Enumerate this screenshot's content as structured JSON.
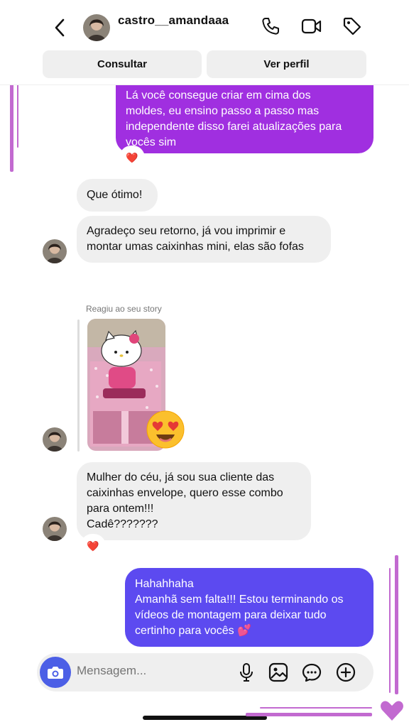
{
  "header": {
    "username": "castro__amandaaa",
    "consult_label": "Consultar",
    "profile_label": "Ver perfil"
  },
  "messages": {
    "m1": {
      "lines": [
        "Lá você consegue criar em cima dos",
        "moldes, eu ensino passo a passo mas",
        "independente disso farei atualizações para",
        "vocês sim"
      ],
      "reaction": "❤️"
    },
    "m2": {
      "lines": [
        "Que ótimo!"
      ]
    },
    "m3": {
      "lines": [
        "Agradeço seu retorno, já vou imprimir e",
        "montar umas caixinhas mini, elas são fofas"
      ]
    },
    "story": {
      "label": "Reagiu ao seu story",
      "reaction": "😍"
    },
    "m4": {
      "lines": [
        "Mulher do céu, já sou sua cliente das",
        "caixinhas envelope, quero esse combo",
        "para ontem!!!",
        "Cadê???????"
      ],
      "reaction": "❤️"
    },
    "m5": {
      "lines": [
        "Hahahhaha",
        "Amanhã sem falta!!! Estou terminando os",
        "vídeos de montagem para deixar tudo",
        "certinho para vocês 💕"
      ]
    }
  },
  "composer": {
    "placeholder": "Mensagem..."
  },
  "icons": {
    "back": "chevron-left-icon",
    "call": "phone-icon",
    "video": "video-camera-icon",
    "tag": "tag-icon",
    "camera": "camera-icon",
    "mic": "microphone-icon",
    "gallery": "image-icon",
    "sticker": "chat-bubble-icon",
    "more": "plus-circle-icon"
  },
  "colors": {
    "sent_purple": "#a02fe0",
    "sent_blue": "#5c4af0",
    "received": "#efefef",
    "camera_button": "#4c5fe6",
    "frame_accent": "#c26ad0"
  }
}
